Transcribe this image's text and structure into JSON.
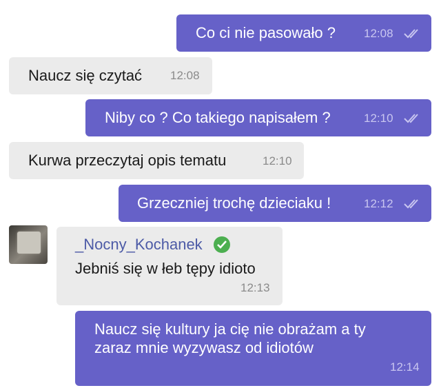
{
  "messages": [
    {
      "text": "Co ci nie pasowało ?",
      "time": "12:08"
    },
    {
      "text": "Naucz się czytać",
      "time": "12:08"
    },
    {
      "text": "Niby co ? Co takiego napisałem ?",
      "time": "12:10"
    },
    {
      "text": "Kurwa przeczytaj opis tematu",
      "time": "12:10"
    },
    {
      "text": "Grzeczniej trochę dzieciaku !",
      "time": "12:12"
    },
    {
      "sender": "_Nocny_Kochanek",
      "text": "Jebniś się w łeb tępy idioto",
      "time": "12:13"
    },
    {
      "line1": "Naucz się kultury ja cię nie obrażam a ty",
      "line2": "zaraz mnie wyzywasz od idiotów",
      "time": "12:14"
    }
  ],
  "icons": {
    "read": "double-check-icon",
    "verified": "verified-check-icon",
    "avatar": "user-avatar"
  },
  "colors": {
    "outgoing": "#6661c8",
    "incoming": "#ebebeb",
    "sender_name": "#4c5aa6",
    "verified": "#4caf50"
  }
}
